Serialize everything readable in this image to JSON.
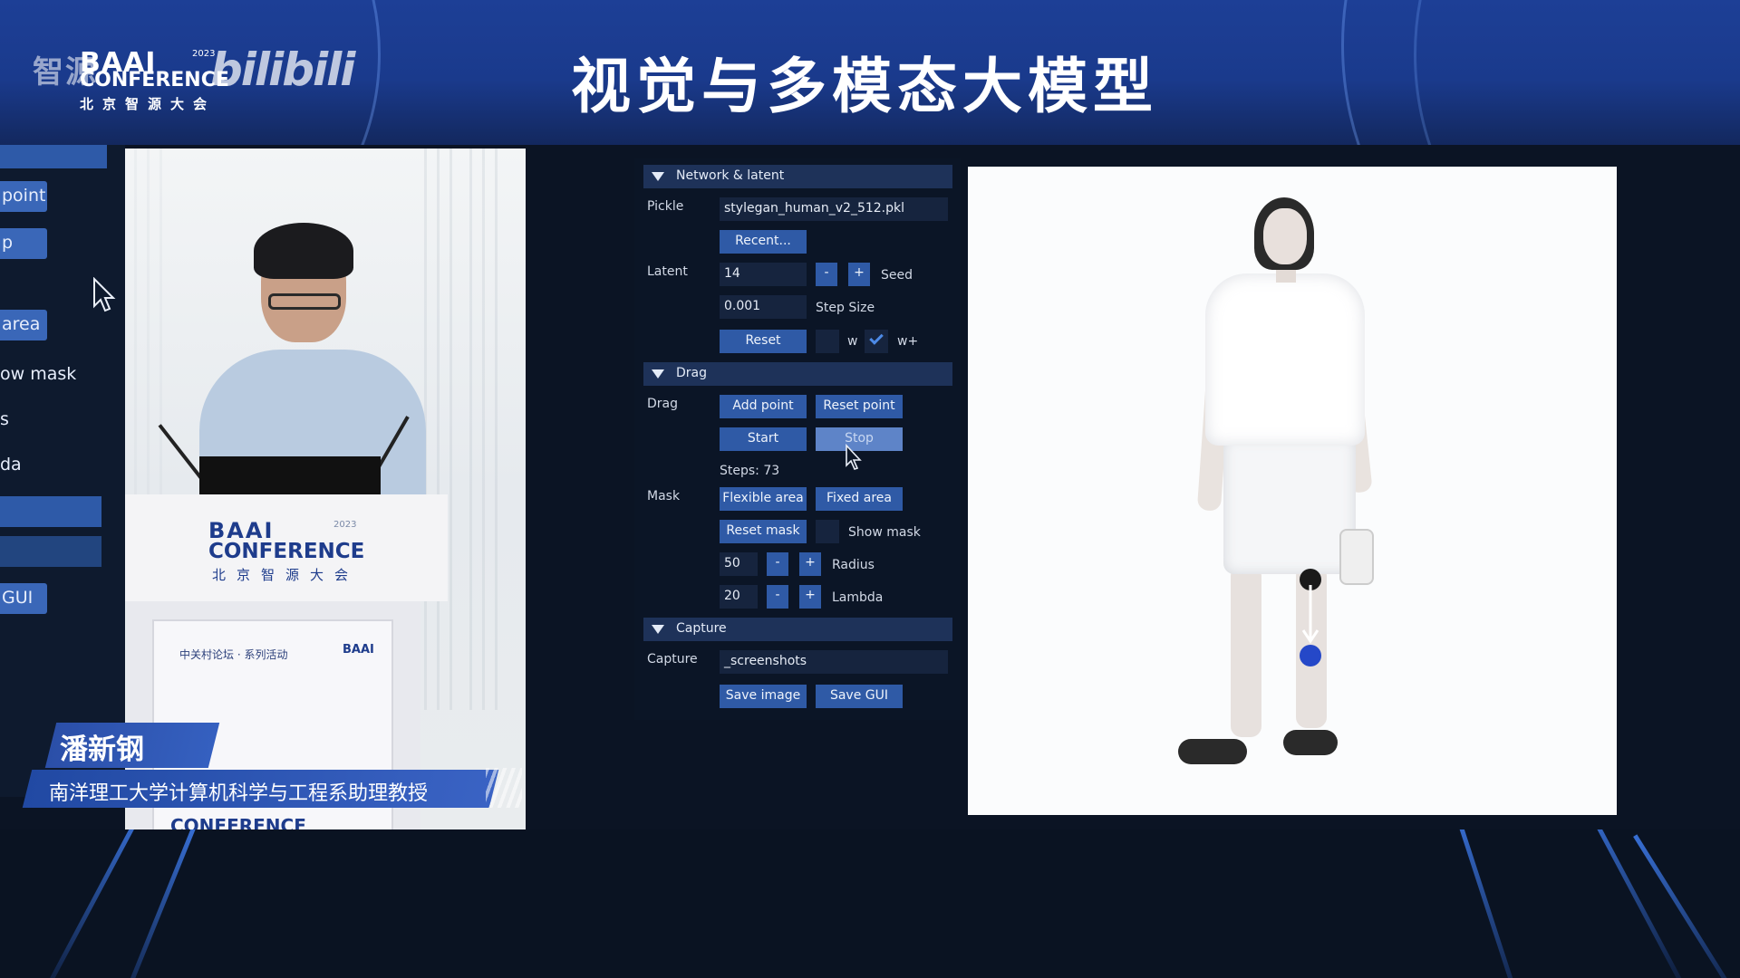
{
  "header": {
    "title": "视觉与多模态大模型",
    "logo": {
      "cn_left": "智源",
      "baai": "BAAI",
      "conference": "CONFERENCE",
      "cn_sub": "北京智源大会",
      "year": "2023",
      "bilibili": "bilibili"
    }
  },
  "left_gui": {
    "items": [
      {
        "type": "button",
        "label": "point"
      },
      {
        "type": "button",
        "label": "p"
      },
      {
        "type": "button",
        "label": "area"
      },
      {
        "type": "text",
        "label": "ow mask"
      },
      {
        "type": "text",
        "label": "s"
      },
      {
        "type": "text",
        "label": "da"
      },
      {
        "type": "button",
        "label": "GUI"
      }
    ]
  },
  "speaker": {
    "name": "潘新钢",
    "role": "南洋理工大学计算机科学与工程系助理教授",
    "podium": {
      "logo_line1": "BAAI",
      "logo_line2": "CONFERENCE",
      "logo_line3": "北京智源大会",
      "year": "2023",
      "panel_left": "中关村论坛 · 系列活动",
      "panel_right": "BAAI",
      "bottom": "CONFERENCE"
    }
  },
  "gui": {
    "sections": {
      "network": "Network & latent",
      "drag": "Drag",
      "capture": "Capture"
    },
    "network": {
      "pickle_label": "Pickle",
      "pickle_value": "stylegan_human_v2_512.pkl",
      "recent_button": "Recent...",
      "latent_label": "Latent",
      "latent_value": "14",
      "minus": "-",
      "plus": "+",
      "seed_label": "Seed",
      "step_value": "0.001",
      "step_label": "Step Size",
      "reset_button": "Reset",
      "w_label": "w",
      "w_plus_label": "w+",
      "w_plus_checked": true
    },
    "drag": {
      "drag_label": "Drag",
      "add_point": "Add point",
      "reset_point": "Reset point",
      "start": "Start",
      "stop": "Stop",
      "steps": "Steps: 73",
      "mask_label": "Mask",
      "flexible_area": "Flexible area",
      "fixed_area": "Fixed area",
      "reset_mask": "Reset mask",
      "show_mask": "Show mask",
      "radius_value": "50",
      "radius_label": "Radius",
      "lambda_value": "20",
      "lambda_label": "Lambda"
    },
    "capture": {
      "capture_label": "Capture",
      "path_value": "_screenshots",
      "save_image": "Save image",
      "save_gui": "Save GUI"
    }
  },
  "colors": {
    "header_blue": "#1d3f96",
    "button_blue": "#2f5aa6",
    "section_blue": "#1e3259",
    "target_point": "#2548c8",
    "handle_point": "#1a1a1a"
  }
}
